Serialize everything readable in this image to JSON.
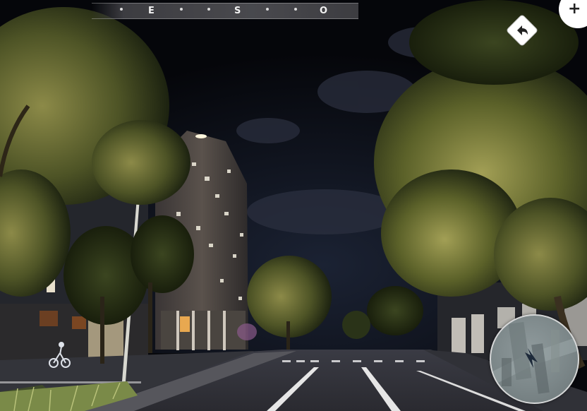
{
  "compass": {
    "headings": [
      "E",
      "S",
      "O"
    ]
  },
  "controls": {
    "add_label": "+",
    "back_icon": "back-arrow-icon",
    "map_marker_icon": "location-arrow-icon"
  }
}
